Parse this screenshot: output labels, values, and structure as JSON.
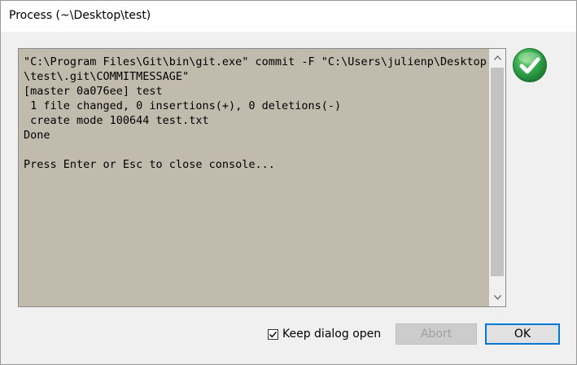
{
  "window": {
    "title": "Process (~\\Desktop\\test)"
  },
  "console": {
    "lines": [
      "\"C:\\Program Files\\Git\\bin\\git.exe\" commit -F \"C:\\Users\\julienp\\Desktop",
      "\\test\\.git\\COMMITMESSAGE\"",
      "[master 0a076ee] test",
      " 1 file changed, 0 insertions(+), 0 deletions(-)",
      " create mode 100644 test.txt",
      "Done",
      "",
      "Press Enter or Esc to close console..."
    ],
    "background_color": "#c0bbad"
  },
  "status": {
    "icon": "success-check-icon",
    "color": "#2ea44a"
  },
  "footer": {
    "keep_open_label": "Keep dialog open",
    "keep_open_checked": true,
    "abort_label": "Abort",
    "abort_enabled": false,
    "ok_label": "OK"
  }
}
